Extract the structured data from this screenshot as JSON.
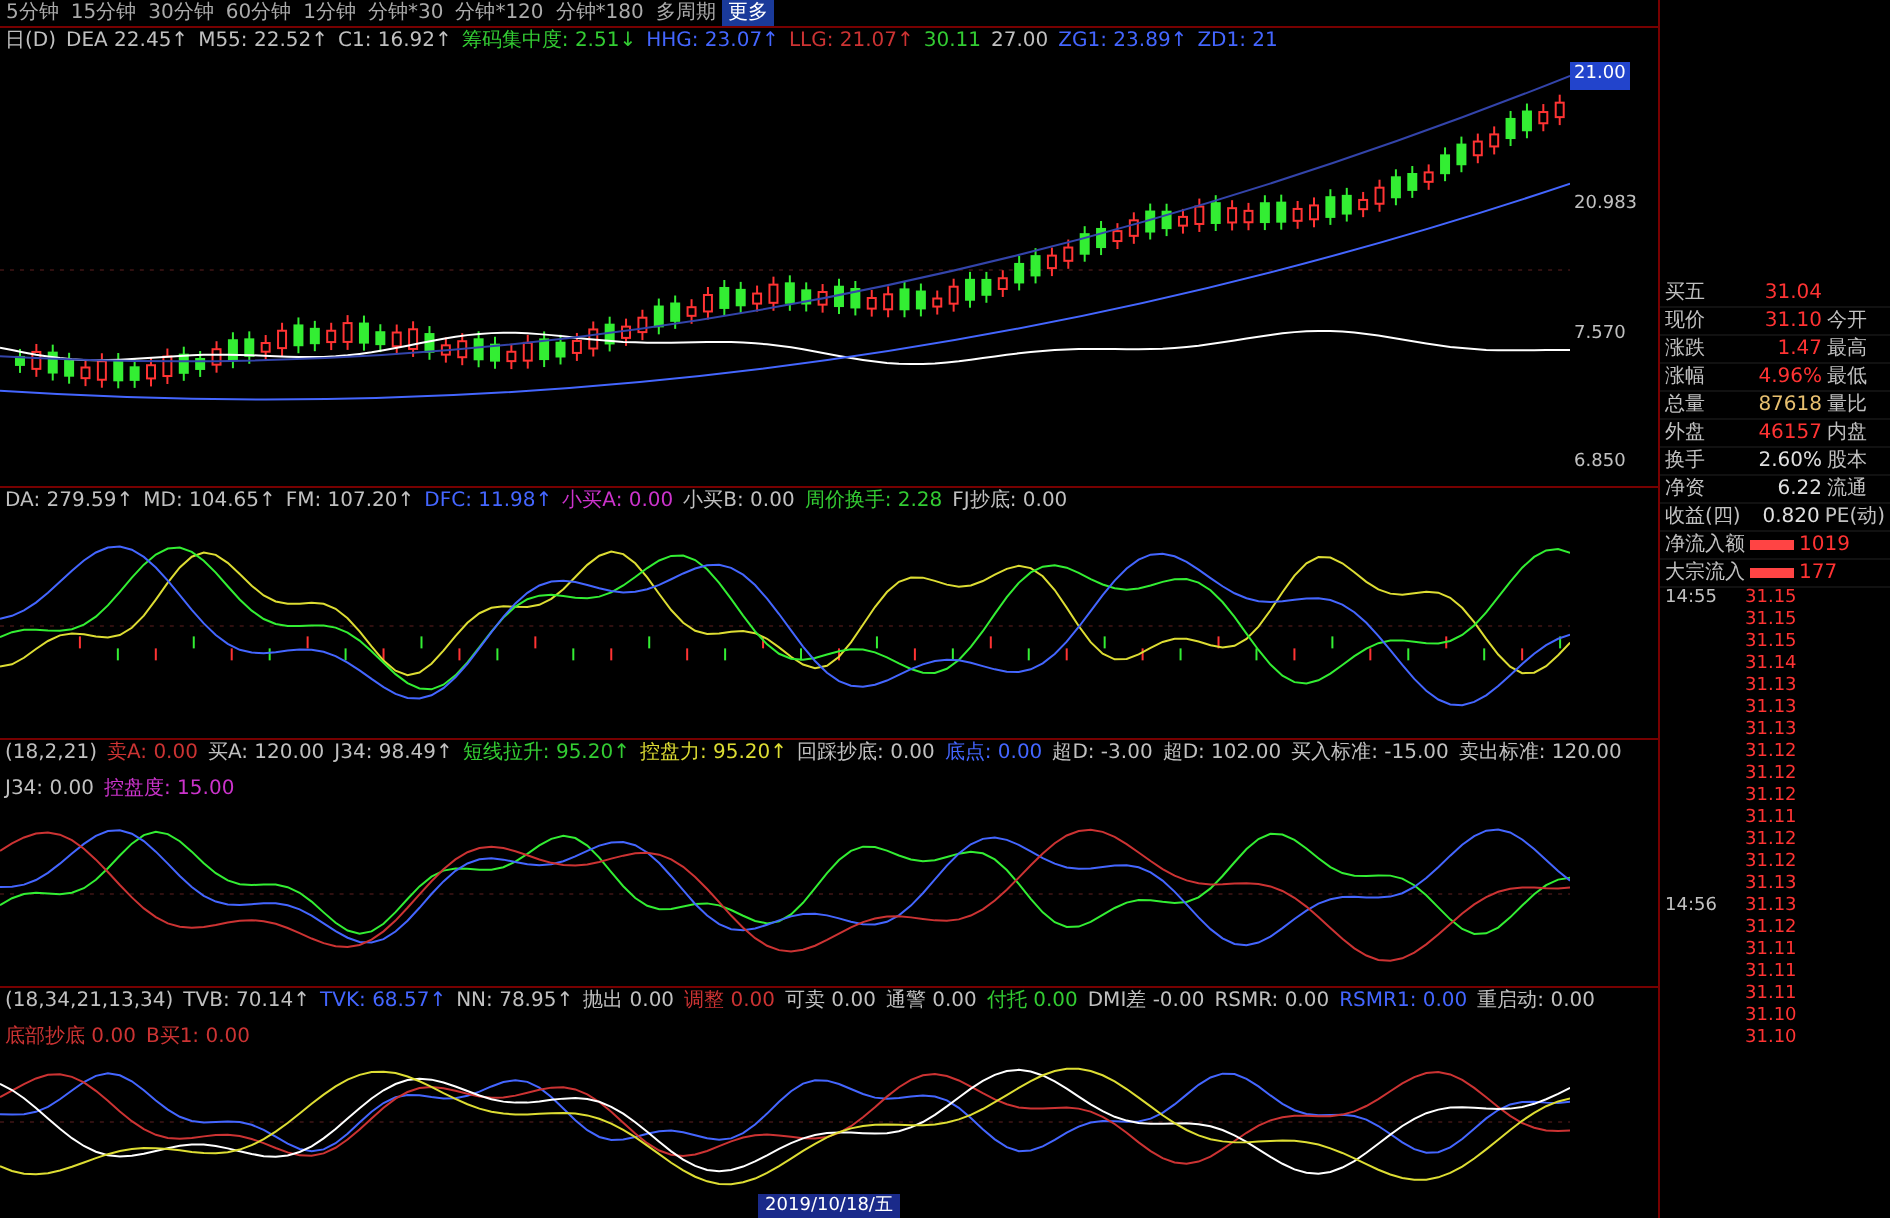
{
  "toolbar": {
    "periods": [
      {
        "label": "5分钟",
        "selected": false
      },
      {
        "label": "15分钟",
        "selected": false
      },
      {
        "label": "30分钟",
        "selected": false
      },
      {
        "label": "60分钟",
        "selected": false
      },
      {
        "label": "1分钟",
        "selected": false
      },
      {
        "label": "分钟*30",
        "selected": false
      },
      {
        "label": "分钟*120",
        "selected": false
      },
      {
        "label": "分钟*180",
        "selected": false
      },
      {
        "label": "多周期",
        "selected": false
      },
      {
        "label": "更多",
        "selected": true
      }
    ]
  },
  "panes": [
    {
      "legend": [
        {
          "text": "日(D)",
          "color": "#c0c0c0"
        },
        {
          "text": "DEA 22.45↑",
          "color": "#c0c0c0"
        },
        {
          "text": "M55: 22.52↑",
          "color": "#c0c0c0"
        },
        {
          "text": "C1: 16.92↑",
          "color": "#c0c0c0"
        },
        {
          "text": "筹码集中度: 2.51↓",
          "color": "#33cc33"
        },
        {
          "text": "HHG: 23.07↑",
          "color": "#4466ff"
        },
        {
          "text": "LLG: 21.07↑",
          "color": "#cc3333"
        },
        {
          "text": "30.11",
          "color": "#33cc33"
        },
        {
          "text": "27.00",
          "color": "#c0c0c0"
        },
        {
          "text": "ZG1: 23.89↑",
          "color": "#4466ff"
        },
        {
          "text": "ZD1: 21",
          "color": "#4466ff"
        }
      ],
      "axis_labels": [
        {
          "text": "21.00",
          "selected": true
        },
        {
          "text": "20.983",
          "selected": false
        },
        {
          "text": "7.570",
          "selected": false
        },
        {
          "text": "6.850",
          "selected": false
        }
      ]
    },
    {
      "legend": [
        {
          "text": "DA: 279.59↑",
          "color": "#c0c0c0"
        },
        {
          "text": "MD: 104.65↑",
          "color": "#c0c0c0"
        },
        {
          "text": "FM: 107.20↑",
          "color": "#c0c0c0"
        },
        {
          "text": "DFC: 11.98↑",
          "color": "#4466ff"
        },
        {
          "text": "小买A: 0.00",
          "color": "#cc33cc"
        },
        {
          "text": "小买B: 0.00",
          "color": "#c0c0c0"
        },
        {
          "text": "周价换手: 2.28",
          "color": "#33cc33"
        },
        {
          "text": "FJ抄底: 0.00",
          "color": "#c0c0c0"
        }
      ]
    },
    {
      "legend": [
        {
          "text": "(18,2,21)",
          "color": "#c0c0c0"
        },
        {
          "text": "卖A: 0.00",
          "color": "#cc3333"
        },
        {
          "text": "买A: 120.00",
          "color": "#c0c0c0"
        },
        {
          "text": "J34: 98.49↑",
          "color": "#c0c0c0"
        },
        {
          "text": "短线拉升: 95.20↑",
          "color": "#33cc33"
        },
        {
          "text": "控盘力: 95.20↑",
          "color": "#dddd33"
        },
        {
          "text": "回踩抄底: 0.00",
          "color": "#c0c0c0"
        },
        {
          "text": "底点: 0.00",
          "color": "#4466ff"
        },
        {
          "text": "超D: -3.00",
          "color": "#c0c0c0"
        },
        {
          "text": "超D: 102.00",
          "color": "#c0c0c0"
        },
        {
          "text": "买入标准: -15.00",
          "color": "#c0c0c0"
        },
        {
          "text": "卖出标准: 120.00",
          "color": "#c0c0c0"
        },
        {
          "text": "J34: 0.00",
          "color": "#c0c0c0"
        },
        {
          "text": "控盘度: 15.00",
          "color": "#cc33cc"
        }
      ]
    },
    {
      "legend": [
        {
          "text": "(18,34,21,13,34)",
          "color": "#c0c0c0"
        },
        {
          "text": "TVB: 70.14↑",
          "color": "#c0c0c0"
        },
        {
          "text": "TVK: 68.57↑",
          "color": "#4466ff"
        },
        {
          "text": "NN: 78.95↑",
          "color": "#c0c0c0"
        },
        {
          "text": "抛出 0.00",
          "color": "#c0c0c0"
        },
        {
          "text": "调整 0.00",
          "color": "#cc3333"
        },
        {
          "text": "可卖 0.00",
          "color": "#c0c0c0"
        },
        {
          "text": "通警 0.00",
          "color": "#c0c0c0"
        },
        {
          "text": "付托 0.00",
          "color": "#33cc33"
        },
        {
          "text": "DMI差 -0.00",
          "color": "#c0c0c0"
        },
        {
          "text": "RSMR: 0.00",
          "color": "#c0c0c0"
        },
        {
          "text": "RSMR1: 0.00",
          "color": "#4466ff"
        },
        {
          "text": "重启动: 0.00",
          "color": "#c0c0c0"
        },
        {
          "text": "底部抄底 0.00",
          "color": "#cc3333"
        },
        {
          "text": "B买1: 0.00",
          "color": "#cc3333"
        }
      ]
    }
  ],
  "date": "2019/10/18/五",
  "quote": [
    {
      "label": "买五",
      "value": "31.04",
      "color": "#ff3333"
    },
    {
      "label": "现价",
      "value": "31.10",
      "label2": "今开",
      "color": "#ff3333"
    },
    {
      "label": "涨跌",
      "value": "1.47",
      "label2": "最高",
      "color": "#ff3333"
    },
    {
      "label": "涨幅",
      "value": "4.96%",
      "label2": "最低",
      "color": "#ff3333"
    },
    {
      "label": "总量",
      "value": "87618",
      "label2": "量比",
      "color": "#e8c070"
    },
    {
      "label": "外盘",
      "value": "46157",
      "label2": "内盘",
      "color": "#ff3333"
    },
    {
      "label": "换手",
      "value": "2.60%",
      "label2": "股本",
      "color": "#e0e0e0"
    },
    {
      "label": "净资",
      "value": "6.22",
      "label2": "流通",
      "color": "#e0e0e0"
    },
    {
      "label": "收益(四)",
      "value": "0.820",
      "label2": "PE(动)",
      "color": "#e0e0e0"
    }
  ],
  "flows": [
    {
      "label": "净流入额",
      "value": "1019"
    },
    {
      "label": "大宗流入",
      "value": "177"
    }
  ],
  "ticks": [
    {
      "time": "14:55",
      "price": "31.15"
    },
    {
      "price": "31.15"
    },
    {
      "price": "31.15"
    },
    {
      "price": "31.14"
    },
    {
      "price": "31.13"
    },
    {
      "price": "31.13"
    },
    {
      "price": "31.13"
    },
    {
      "price": "31.12"
    },
    {
      "price": "31.12"
    },
    {
      "price": "31.12"
    },
    {
      "price": "31.11"
    },
    {
      "price": "31.12"
    },
    {
      "price": "31.12"
    },
    {
      "price": "31.13"
    },
    {
      "time": "14:56",
      "price": "31.13"
    },
    {
      "price": "31.12"
    },
    {
      "price": "31.11"
    },
    {
      "price": "31.11"
    },
    {
      "price": "31.11"
    },
    {
      "price": "31.10"
    },
    {
      "price": "31.10"
    }
  ]
}
